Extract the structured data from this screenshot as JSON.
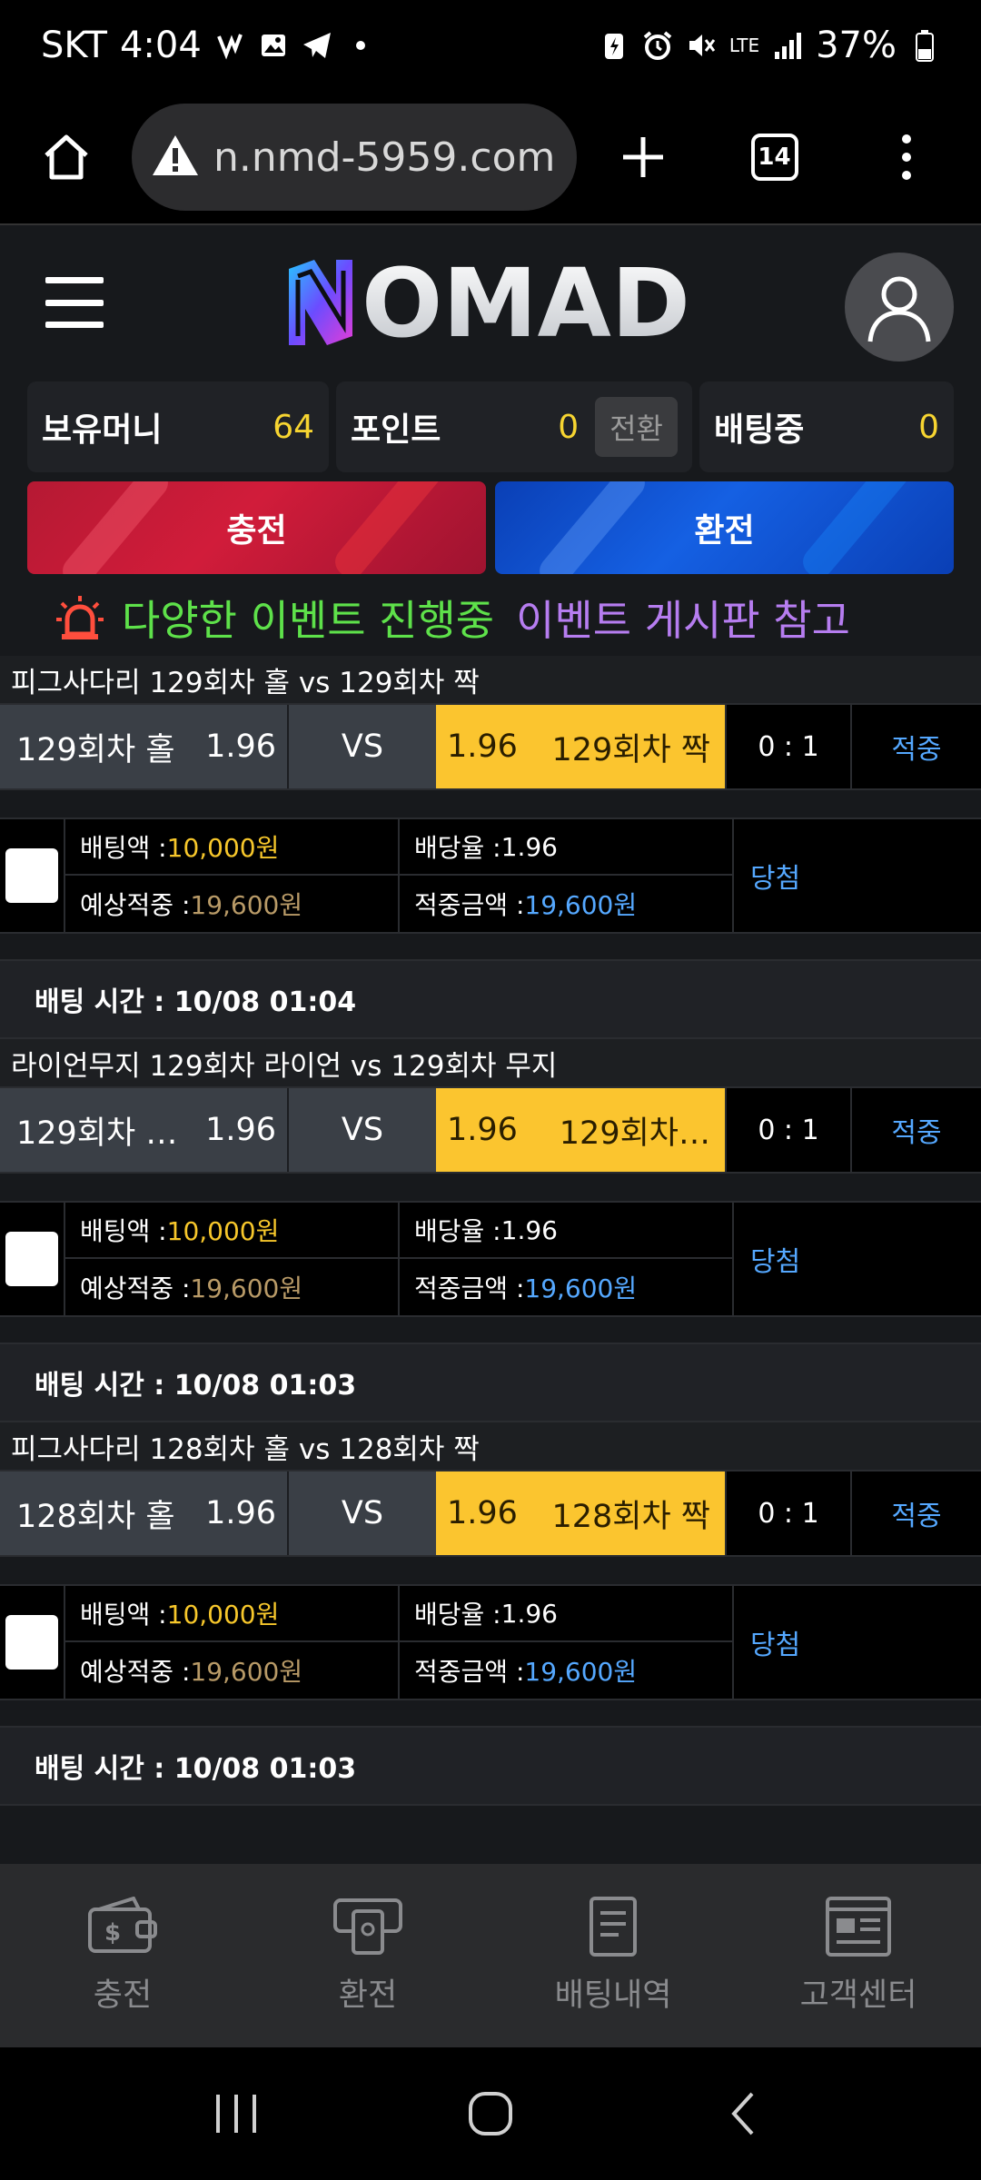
{
  "status_bar": {
    "carrier": "SKT",
    "time": "4:04",
    "network": "LTE",
    "battery": "37%"
  },
  "browser": {
    "url": "n.nmd-5959.com",
    "tab_count": "14"
  },
  "site": {
    "logo_text": "NOMAD"
  },
  "info": {
    "money_label": "보유머니",
    "money_value": "64",
    "point_label": "포인트",
    "point_value": "0",
    "convert_label": "전환",
    "betting_label": "배팅중",
    "betting_value": "0"
  },
  "actions": {
    "deposit_label": "충전",
    "withdraw_label": "환전"
  },
  "notice": {
    "green_text": "다양한 이벤트 진행중",
    "purple_text": "이벤트 게시판 참고"
  },
  "bets": [
    {
      "title": "피그사다리 129회차 홀  vs  129회차 짝",
      "home_team": "129회차 홀",
      "home_odds": "1.96",
      "vs": "VS",
      "away_odds": "1.96",
      "away_team": "129회차 짝",
      "score": "0 : 1",
      "result": "적중",
      "bet_amount_label": "배팅액 : ",
      "bet_amount": "10,000원",
      "odds_label": "배당율 : ",
      "odds": "1.96",
      "expected_label": "예상적중 : ",
      "expected": "19,600원",
      "win_label": "적중금액 : ",
      "win_amount": "19,600원",
      "status": "당첨",
      "time_label": "배팅 시간 : 10/08 01:04"
    },
    {
      "title": "라이언무지 129회차 라이언  vs  129회차 무지",
      "home_team": "129회차 …",
      "home_odds": "1.96",
      "vs": "VS",
      "away_odds": "1.96",
      "away_team": "129회차…",
      "score": "0 : 1",
      "result": "적중",
      "bet_amount_label": "배팅액 : ",
      "bet_amount": "10,000원",
      "odds_label": "배당율 : ",
      "odds": "1.96",
      "expected_label": "예상적중 : ",
      "expected": "19,600원",
      "win_label": "적중금액 : ",
      "win_amount": "19,600원",
      "status": "당첨",
      "time_label": "배팅 시간 : 10/08 01:03"
    },
    {
      "title": "피그사다리 128회차 홀  vs  128회차 짝",
      "home_team": "128회차 홀",
      "home_odds": "1.96",
      "vs": "VS",
      "away_odds": "1.96",
      "away_team": "128회차 짝",
      "score": "0 : 1",
      "result": "적중",
      "bet_amount_label": "배팅액 : ",
      "bet_amount": "10,000원",
      "odds_label": "배당율 : ",
      "odds": "1.96",
      "expected_label": "예상적중 : ",
      "expected": "19,600원",
      "win_label": "적중금액 : ",
      "win_amount": "19,600원",
      "status": "당첨",
      "time_label": "배팅 시간 : 10/08 01:03"
    }
  ],
  "bottom_nav": {
    "deposit": "충전",
    "withdraw": "환전",
    "history": "배팅내역",
    "support": "고객센터"
  },
  "colors": {
    "accent_yellow": "#fbc52f",
    "win_blue": "#55a8ff",
    "notice_green": "#5ee14a",
    "notice_purple": "#b67df0"
  }
}
